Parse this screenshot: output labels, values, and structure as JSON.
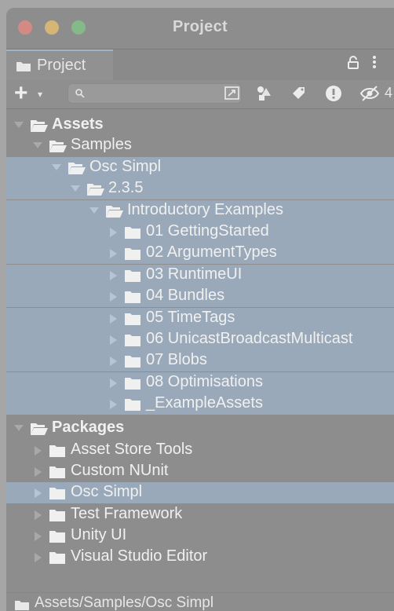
{
  "window": {
    "title": "Project"
  },
  "tab": {
    "label": "Project",
    "lock_icon": "lock-icon",
    "menu_icon": "kebab-menu-icon"
  },
  "toolbar": {
    "create_label": "+",
    "create_arrow": "▾",
    "search_placeholder": "",
    "search_value": "",
    "hidden_count": "4"
  },
  "tree": {
    "items": [
      {
        "label": "Assets",
        "bold": true,
        "expanded": true,
        "selected": false
      },
      {
        "label": "Samples",
        "bold": false,
        "expanded": true,
        "selected": false
      },
      {
        "label": "Osc Simpl",
        "bold": false,
        "expanded": true,
        "selected": true
      },
      {
        "label": "2.3.5",
        "bold": false,
        "expanded": true,
        "selected": true
      },
      {
        "label": "Introductory Examples",
        "bold": false,
        "expanded": true,
        "selected": true
      },
      {
        "label": "01 GettingStarted",
        "bold": false,
        "expanded": false,
        "selected": true
      },
      {
        "label": "02 ArgumentTypes",
        "bold": false,
        "expanded": false,
        "selected": true
      },
      {
        "label": "03 RuntimeUI",
        "bold": false,
        "expanded": false,
        "selected": true
      },
      {
        "label": "04 Bundles",
        "bold": false,
        "expanded": false,
        "selected": true
      },
      {
        "label": "05 TimeTags",
        "bold": false,
        "expanded": false,
        "selected": true
      },
      {
        "label": "06 UnicastBroadcastMulticast",
        "bold": false,
        "expanded": false,
        "selected": true
      },
      {
        "label": "07 Blobs",
        "bold": false,
        "expanded": false,
        "selected": true
      },
      {
        "label": "08 Optimisations",
        "bold": false,
        "expanded": false,
        "selected": true
      },
      {
        "label": "_ExampleAssets",
        "bold": false,
        "expanded": false,
        "selected": true
      },
      {
        "label": "Packages",
        "bold": true,
        "expanded": true,
        "selected": false
      },
      {
        "label": "Asset Store Tools",
        "bold": false,
        "expanded": false,
        "selected": false
      },
      {
        "label": "Custom NUnit",
        "bold": false,
        "expanded": false,
        "selected": false
      },
      {
        "label": "Osc Simpl",
        "bold": false,
        "expanded": false,
        "selected": true
      },
      {
        "label": "Test Framework",
        "bold": false,
        "expanded": false,
        "selected": false
      },
      {
        "label": "Unity UI",
        "bold": false,
        "expanded": false,
        "selected": false
      },
      {
        "label": "Visual Studio Editor",
        "bold": false,
        "expanded": false,
        "selected": false
      }
    ]
  },
  "status": {
    "path": "Assets/Samples/Osc Simpl"
  }
}
